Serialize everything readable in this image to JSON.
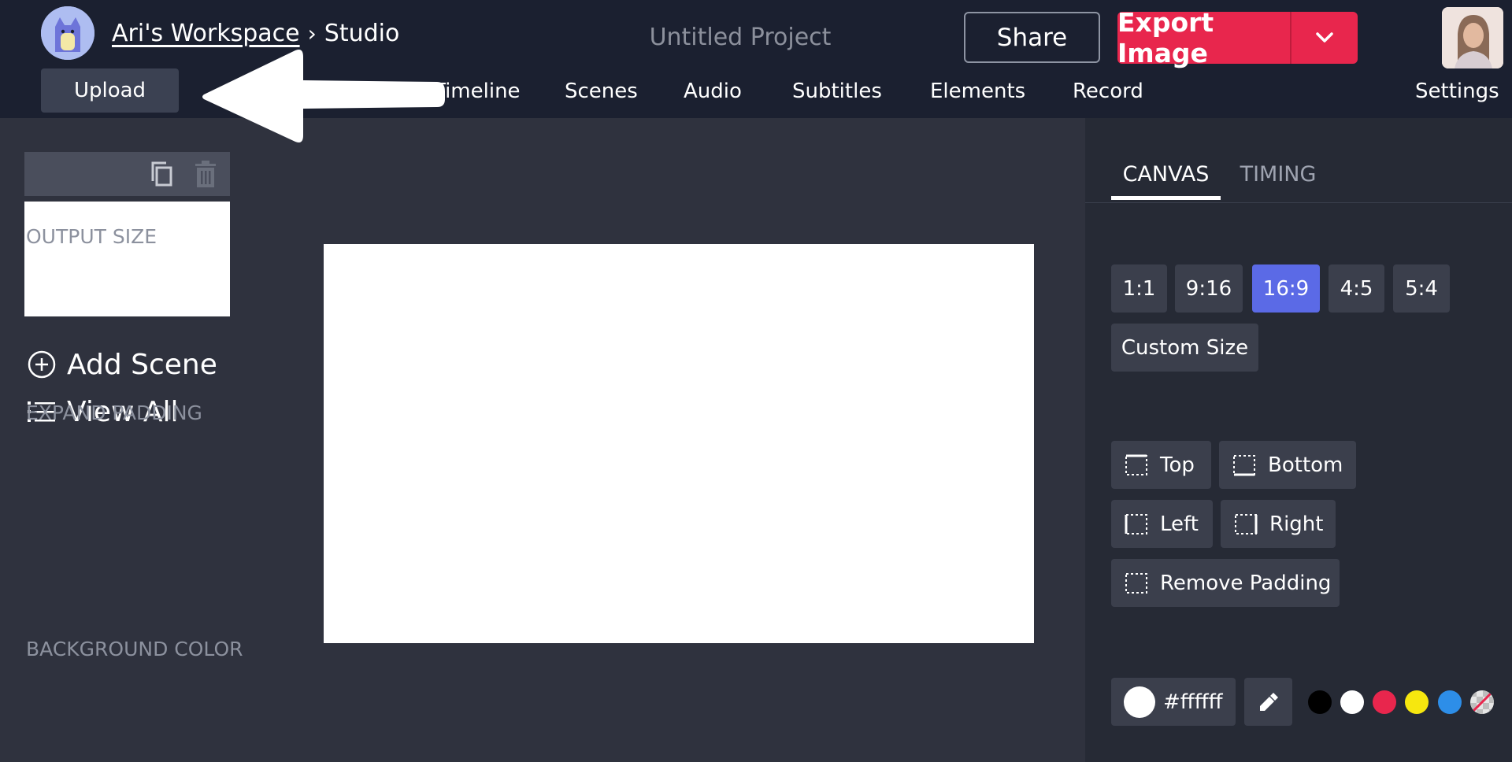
{
  "header": {
    "breadcrumb": {
      "workspace": "Ari's Workspace",
      "separator": "›",
      "current": "Studio"
    },
    "project_title": "Untitled Project",
    "share_label": "Share",
    "export_label": "Export Image",
    "upload_label": "Upload",
    "nav": [
      "Timeline",
      "Scenes",
      "Audio",
      "Subtitles",
      "Elements",
      "Record"
    ],
    "settings_label": "Settings"
  },
  "sidebar": {
    "add_scene": "Add Scene",
    "view_all": "View All"
  },
  "panel": {
    "tabs": [
      "CANVAS",
      "TIMING"
    ],
    "output_size_label": "OUTPUT SIZE",
    "sizes": [
      "1:1",
      "9:16",
      "16:9",
      "4:5",
      "5:4"
    ],
    "selected_size": "16:9",
    "custom_size": "Custom Size",
    "expand_padding_label": "EXPAND PADDING",
    "padding": [
      "Top",
      "Bottom",
      "Left",
      "Right",
      "Remove Padding"
    ],
    "background_color_label": "BACKGROUND COLOR",
    "background_hex": "#ffffff",
    "swatches": [
      "#000000",
      "#ffffff",
      "#e8264d",
      "#f6e70f",
      "#2d8ee8",
      "transparent"
    ]
  },
  "colors": {
    "accent": "#5b6ae6",
    "export": "#e8264d",
    "header_bg": "#1b2030",
    "panel_bg": "#262a35"
  }
}
